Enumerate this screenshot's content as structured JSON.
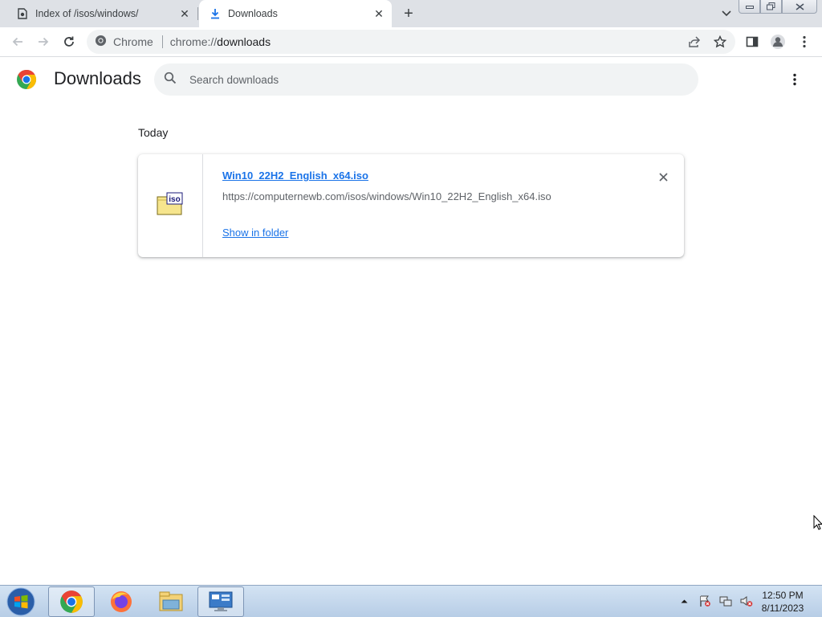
{
  "browser": {
    "tabs": [
      {
        "title": "Index of /isos/windows/",
        "active": false,
        "icon": "page-icon"
      },
      {
        "title": "Downloads",
        "active": true,
        "icon": "download-icon"
      }
    ],
    "omnibox": {
      "site_label": "Chrome",
      "url_scheme": "chrome://",
      "url_host": "downloads"
    }
  },
  "downloads_page": {
    "title": "Downloads",
    "search_placeholder": "Search downloads",
    "section": "Today",
    "items": [
      {
        "file_name": "Win10_22H2_English_x64.iso",
        "url": "https://computernewb.com/isos/windows/Win10_22H2_English_x64.iso",
        "action": "Show in folder",
        "icon": "iso-file-icon"
      }
    ]
  },
  "taskbar": {
    "apps": [
      "chrome",
      "firefox",
      "file-explorer",
      "control-panel"
    ],
    "clock": {
      "time": "12:50 PM",
      "date": "8/11/2023"
    }
  },
  "colors": {
    "accent": "#1a73e8",
    "tab_strip": "#dee1e6",
    "omnibox": "#f1f3f4"
  }
}
